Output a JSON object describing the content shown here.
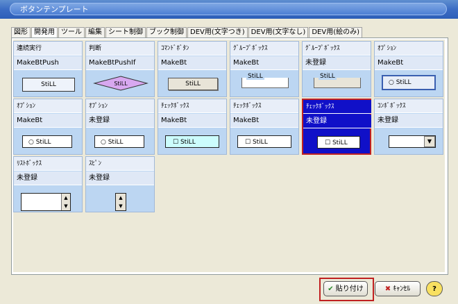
{
  "window": {
    "title": "ボタンテンプレート"
  },
  "tabs": [
    "図形",
    "開発用",
    "ツール",
    "編集",
    "シート制御",
    "ブック制御",
    "DEV用(文字つき)",
    "DEV用(文字なし)",
    "DEV用(絵のみ)"
  ],
  "active_tab": "開発用",
  "cards": [
    {
      "name": "連続実行",
      "macro": "MakeBtPush",
      "sample": "StiLL"
    },
    {
      "name": "判断",
      "macro": "MakeBtPushIf",
      "sample": "StiLL"
    },
    {
      "name": "ｺﾏﾝﾄﾞﾎﾞﾀﾝ",
      "macro": "MakeBt",
      "sample": "StiLL"
    },
    {
      "name": "ｸﾞﾙｰﾌﾟﾎﾞｯｸｽ",
      "macro": "MakeBt",
      "sample": "StiLL"
    },
    {
      "name": "ｸﾞﾙｰﾌﾟﾎﾞｯｸｽ",
      "macro": "未登録",
      "sample": "StiLL"
    },
    {
      "name": "ｵﾌﾟｼｮﾝ",
      "macro": "MakeBt",
      "sample": "StiLL"
    },
    {
      "name": "ｵﾌﾟｼｮﾝ",
      "macro": "MakeBt",
      "sample": "StiLL"
    },
    {
      "name": "ｵﾌﾟｼｮﾝ",
      "macro": "未登録",
      "sample": "StiLL"
    },
    {
      "name": "ﾁｪｯｸﾎﾞｯｸｽ",
      "macro": "MakeBt",
      "sample": "StiLL"
    },
    {
      "name": "ﾁｪｯｸﾎﾞｯｸｽ",
      "macro": "MakeBt",
      "sample": "StiLL"
    },
    {
      "name": "ﾁｪｯｸﾎﾞｯｸｽ",
      "macro": "未登録",
      "sample": "StiLL"
    },
    {
      "name": "ｺﾝﾎﾞﾎﾞｯｸｽ",
      "macro": "未登録",
      "sample": ""
    },
    {
      "name": "ﾘｽﾄﾎﾞｯｸｽ",
      "macro": "未登録",
      "sample": ""
    },
    {
      "name": "ｽﾋﾟﾝ",
      "macro": "未登録",
      "sample": ""
    }
  ],
  "selected_card": 10,
  "footer": {
    "paste": "貼り付け",
    "cancel": "ｷｬﾝｾﾙ",
    "help": "?"
  },
  "colors": {
    "accent": "#3b6cc4",
    "selected": "#1010c8",
    "highlight": "#c02020"
  }
}
